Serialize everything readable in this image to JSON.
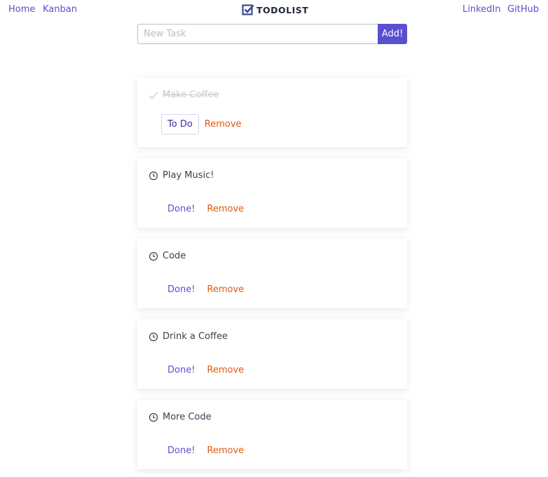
{
  "nav": {
    "left": [
      "Home",
      "Kanban"
    ],
    "right": [
      "LinkedIn",
      "GitHub"
    ],
    "logo_text": "TODOLIST"
  },
  "add_task": {
    "placeholder": "New Task",
    "value": "",
    "button_label": "Add!"
  },
  "colors": {
    "accent": "#5a4fcf",
    "remove": "#dd5a12",
    "done_text": "#c4c8cf"
  },
  "tasks": [
    {
      "title": "Make Coffee",
      "status": "done",
      "icon": "check-icon",
      "primary_action": "To Do",
      "remove_label": "Remove"
    },
    {
      "title": "Play Music!",
      "status": "pending",
      "icon": "clock-icon",
      "primary_action": "Done!",
      "remove_label": "Remove"
    },
    {
      "title": "Code",
      "status": "pending",
      "icon": "clock-icon",
      "primary_action": "Done!",
      "remove_label": "Remove"
    },
    {
      "title": "Drink a Coffee",
      "status": "pending",
      "icon": "clock-icon",
      "primary_action": "Done!",
      "remove_label": "Remove"
    },
    {
      "title": "More Code",
      "status": "pending",
      "icon": "clock-icon",
      "primary_action": "Done!",
      "remove_label": "Remove"
    }
  ]
}
